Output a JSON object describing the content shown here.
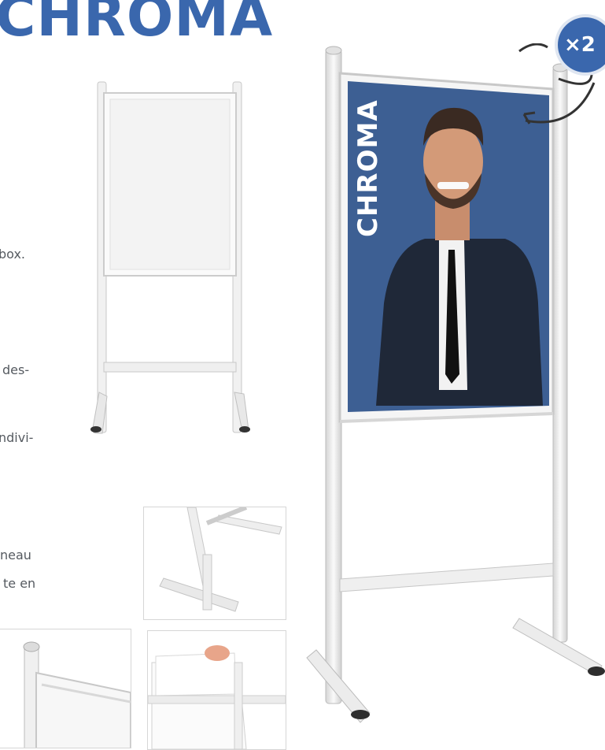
{
  "header": {
    "title": "CHROMA"
  },
  "body_text": {
    "frag1": "box.",
    "frag2": "des-",
    "frag3": "ndivi-",
    "frag4": "neau",
    "frag5": "te en"
  },
  "poster": {
    "vertical_text": "CHROMA"
  },
  "badge": {
    "label": "×2"
  },
  "colors": {
    "brand": "#3a67ad",
    "poster_bg": "#3d5f93",
    "frame": "#e6e6e6"
  }
}
